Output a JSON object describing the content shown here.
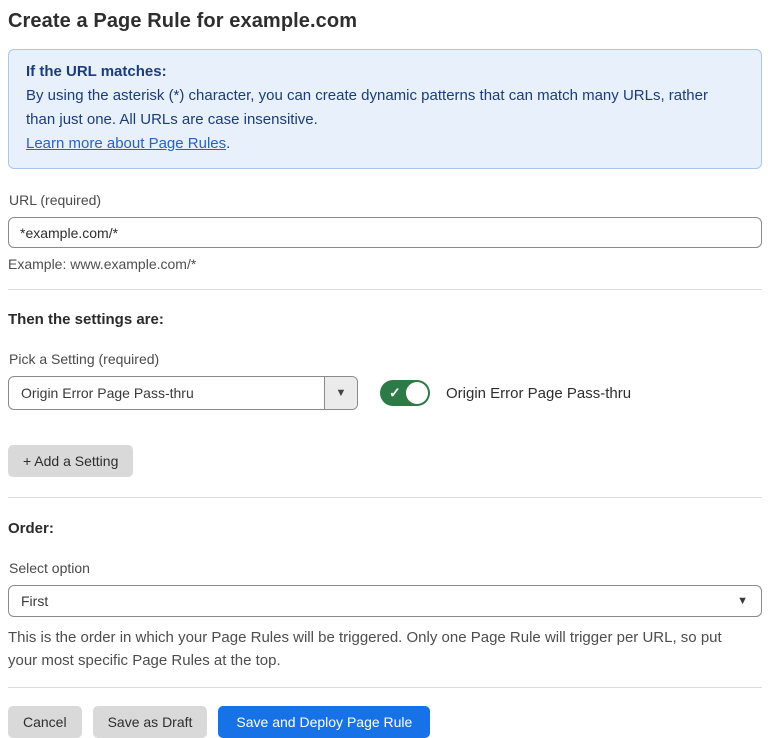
{
  "page": {
    "title": "Create a Page Rule for example.com"
  },
  "info_box": {
    "heading": "If the URL matches:",
    "body": "By using the asterisk (*) character, you can create dynamic patterns that can match many URLs, rather than just one. All URLs are case insensitive.",
    "link_label": "Learn more about Page Rules",
    "link_suffix": "."
  },
  "url_field": {
    "label": "URL (required)",
    "value": "*example.com/*",
    "helper": "Example: www.example.com/*"
  },
  "settings_section": {
    "heading": "Then the settings are:",
    "picker_label": "Pick a Setting (required)",
    "picker_value": "Origin Error Page Pass-thru",
    "picker_arrow_icon": "▼",
    "toggle_state": "on",
    "toggle_check_icon": "✓",
    "toggle_label": "Origin Error Page Pass-thru",
    "add_setting_label": "+ Add a Setting"
  },
  "order_section": {
    "heading": "Order:",
    "select_label": "Select option",
    "select_value": "First",
    "select_arrow_icon": "▼",
    "helper": "This is the order in which your Page Rules will be triggered. Only one Page Rule will trigger per URL, so put your most specific Page Rules at the top."
  },
  "footer": {
    "cancel_label": "Cancel",
    "save_draft_label": "Save as Draft",
    "save_deploy_label": "Save and Deploy Page Rule"
  },
  "colors": {
    "info_bg": "#e8f1fb",
    "info_border": "#a9c8ea",
    "info_text": "#1b3c7c",
    "link_blue": "#2563c8",
    "toggle_green": "#2c7b46",
    "primary_blue": "#1672e6",
    "button_gray": "#d9d9d9"
  }
}
